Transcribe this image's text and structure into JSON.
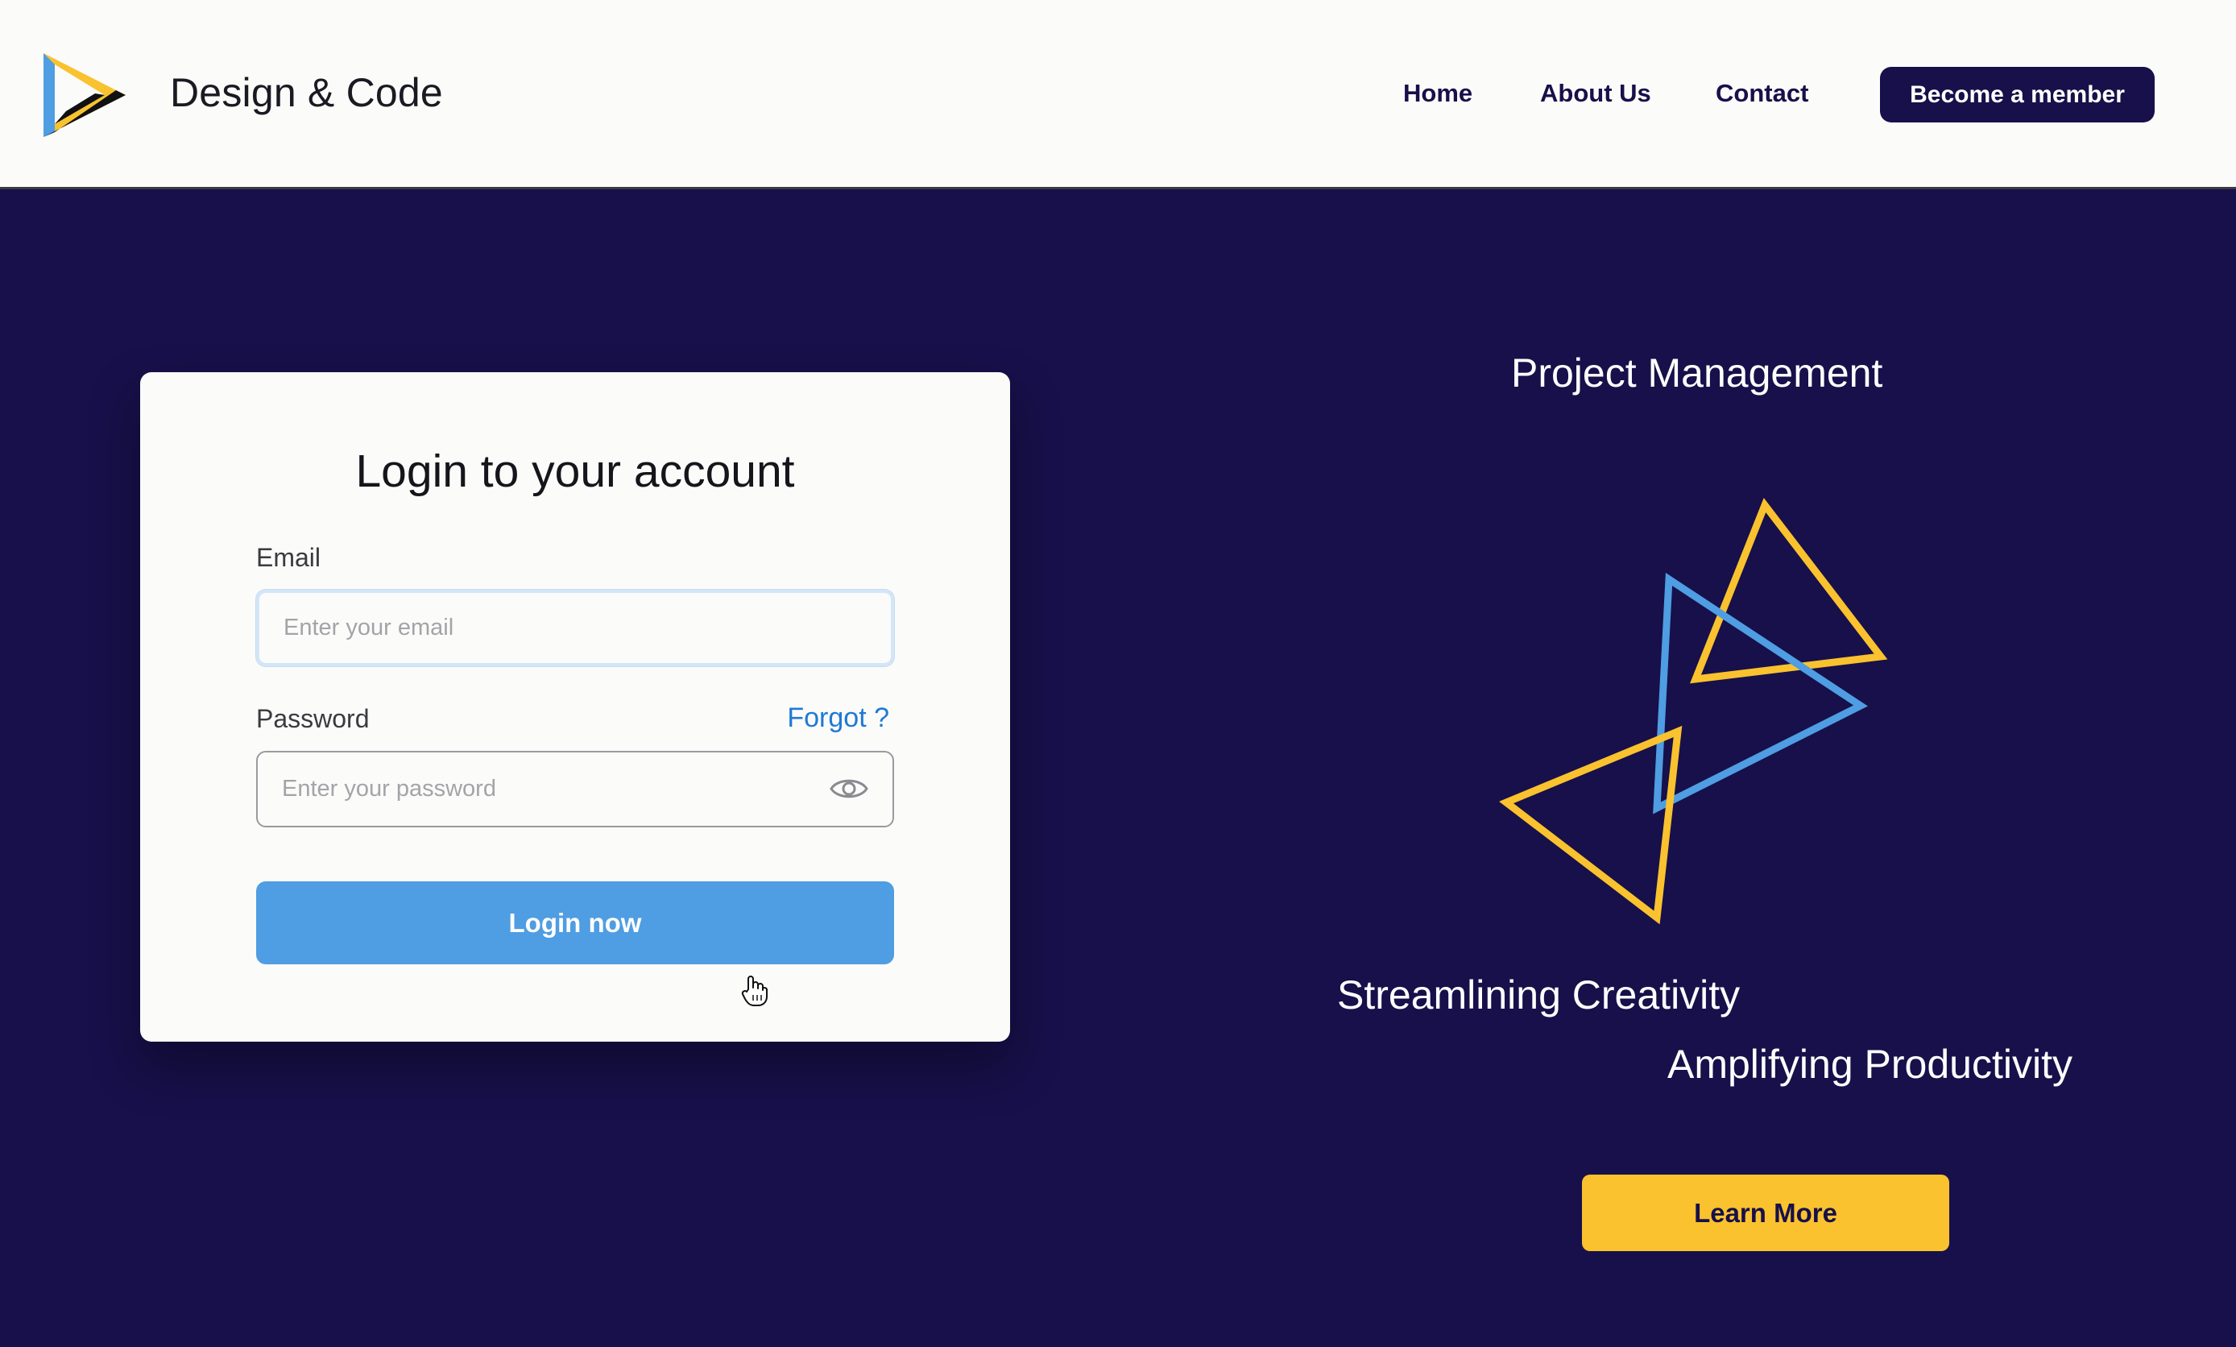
{
  "header": {
    "brand_name": "Design & Code",
    "nav": {
      "home": "Home",
      "about": "About Us",
      "contact": "Contact"
    },
    "member_button": "Become a  member"
  },
  "login": {
    "title": "Login to your account",
    "email_label": "Email",
    "email_placeholder": "Enter your email",
    "email_value": "",
    "password_label": "Password",
    "forgot_link": "Forgot ?",
    "password_placeholder": "Enter your password",
    "password_value": "",
    "submit_button": "Login now"
  },
  "promo": {
    "title": "Project Management",
    "tagline_1": "Streamlining Creativity",
    "tagline_2": "Amplifying Productivity",
    "cta_button": "Learn More"
  },
  "icons": {
    "logo": "triangle-logo-icon",
    "password_toggle": "eye-icon",
    "pointer": "hand-pointer-cursor-icon",
    "illustration": "triangles-illustration"
  },
  "colors": {
    "navy": "#17104a",
    "header_bg": "#fbfbfa",
    "login_button": "#4f9de2",
    "link_blue": "#1f79d4",
    "accent_yellow": "#f9c22e",
    "accent_blue": "#4f9de2"
  }
}
